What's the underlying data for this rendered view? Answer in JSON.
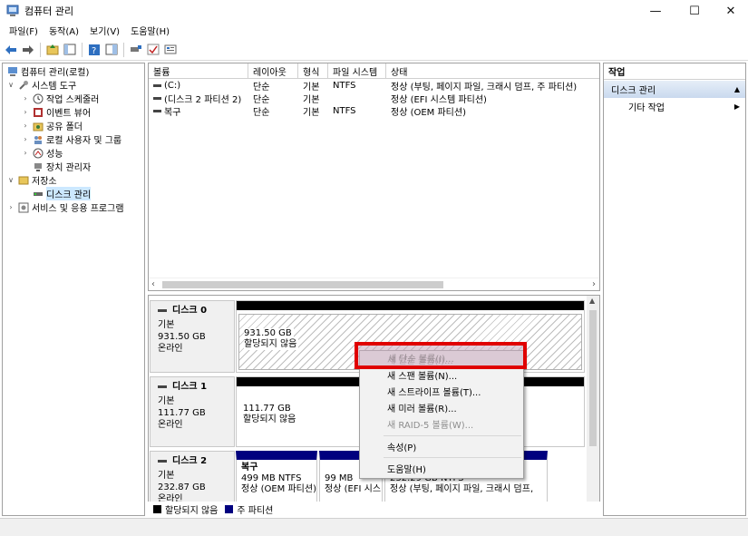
{
  "window": {
    "title": "컴퓨터 관리",
    "minimize": "—",
    "maximize": "☐",
    "close": "✕"
  },
  "menu": [
    "파일(F)",
    "동작(A)",
    "보기(V)",
    "도움말(H)"
  ],
  "tree": {
    "root": "컴퓨터 관리(로컬)",
    "system_tools": "시스템 도구",
    "task_scheduler": "작업 스케줄러",
    "event_viewer": "이벤트 뷰어",
    "shared_folders": "공유 폴더",
    "local_users": "로컬 사용자 및 그룹",
    "performance": "성능",
    "device_manager": "장치 관리자",
    "storage": "저장소",
    "disk_management": "디스크 관리",
    "services": "서비스 및 응용 프로그램"
  },
  "volumes": {
    "headers": [
      "볼륨",
      "레이아웃",
      "형식",
      "파일 시스템",
      "상태"
    ],
    "rows": [
      {
        "name": "(C:)",
        "layout": "단순",
        "type": "기본",
        "fs": "NTFS",
        "status": "정상 (부팅, 페이지 파일, 크래시 덤프, 주 파티션)"
      },
      {
        "name": "(디스크 2 파티션 2)",
        "layout": "단순",
        "type": "기본",
        "fs": "",
        "status": "정상 (EFI 시스템 파티션)"
      },
      {
        "name": "복구",
        "layout": "단순",
        "type": "기본",
        "fs": "NTFS",
        "status": "정상 (OEM 파티션)"
      }
    ]
  },
  "disks": {
    "disk0": {
      "name": "디스크 0",
      "type": "기본",
      "size": "931.50 GB",
      "state": "온라인",
      "part_size": "931.50 GB",
      "part_status": "할당되지 않음"
    },
    "disk1": {
      "name": "디스크 1",
      "type": "기본",
      "size": "111.77 GB",
      "state": "온라인",
      "part_size": "111.77 GB",
      "part_status": "할당되지 않음"
    },
    "disk2": {
      "name": "디스크 2",
      "type": "기본",
      "size": "232.87 GB",
      "state": "온라인",
      "p1_name": "복구",
      "p1_size": "499 MB NTFS",
      "p1_status": "정상 (OEM 파티션)",
      "p2_size": "99 MB",
      "p2_status": "정상 (EFI 시스",
      "p3_size": "232.29 GB NTFS",
      "p3_status": "정상 (부팅, 페이지 파일, 크래시 덤프,"
    }
  },
  "legend": {
    "unallocated": "할당되지 않음",
    "primary": "주 파티션"
  },
  "context_menu": {
    "new_simple": "새 단순 볼륨(I)...",
    "new_spanned": "새 스팬 볼륨(N)...",
    "new_striped": "새 스트라이프 볼륨(T)...",
    "new_mirrored": "새 미러 볼륨(R)...",
    "new_raid5": "새 RAID-5 볼륨(W)...",
    "properties": "속성(P)",
    "help": "도움말(H)"
  },
  "actions": {
    "header": "작업",
    "section": "디스크 관리",
    "more": "기타 작업"
  },
  "colors": {
    "primary_partition": "#00007f",
    "unallocated": "#000000",
    "highlight": "#e00000",
    "action_section": "#c9d9ee"
  }
}
